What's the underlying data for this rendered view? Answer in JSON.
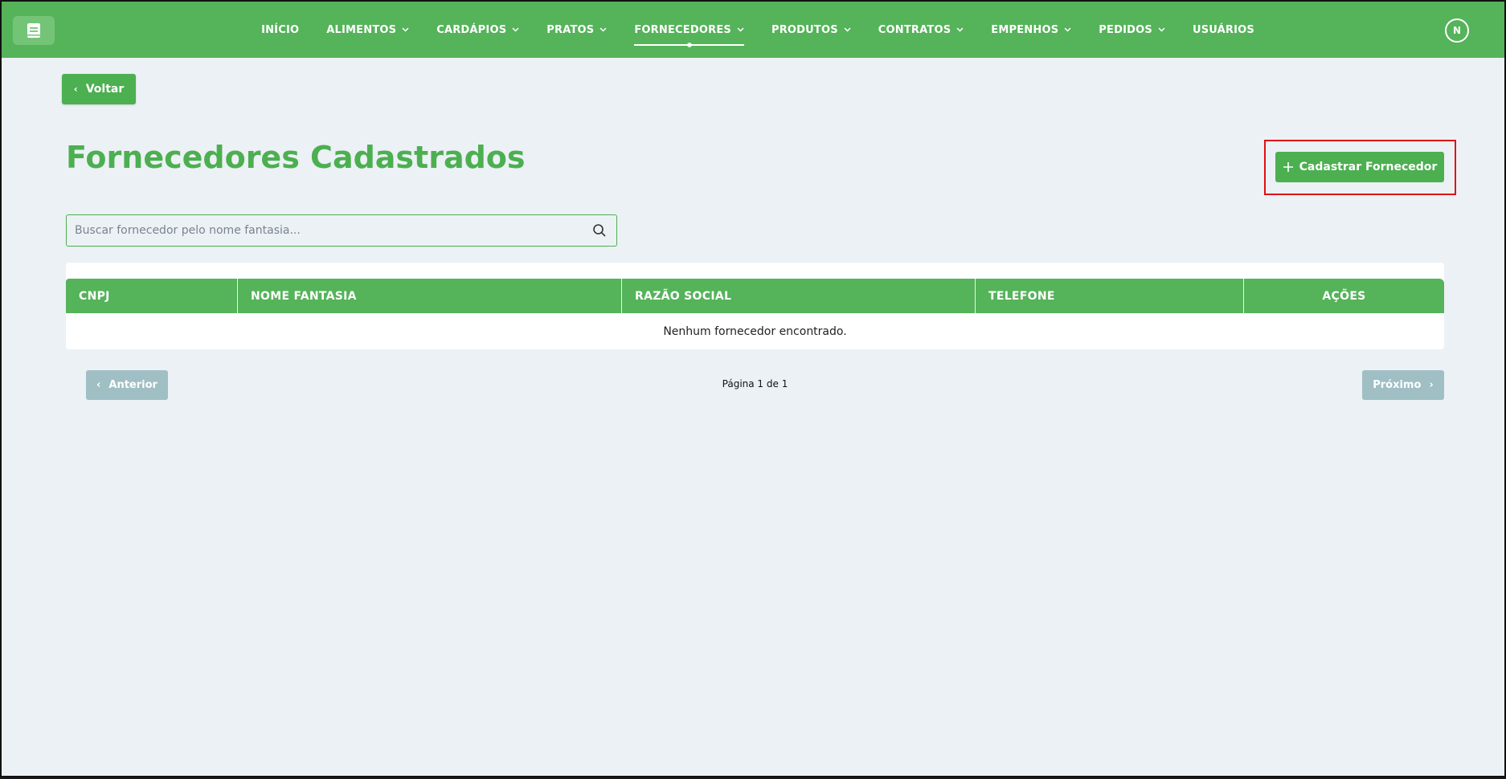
{
  "nav": {
    "items": [
      {
        "label": "INÍCIO",
        "dropdown": false,
        "active": false
      },
      {
        "label": "ALIMENTOS",
        "dropdown": true,
        "active": false
      },
      {
        "label": "CARDÁPIOS",
        "dropdown": true,
        "active": false
      },
      {
        "label": "PRATOS",
        "dropdown": true,
        "active": false
      },
      {
        "label": "FORNECEDORES",
        "dropdown": true,
        "active": true
      },
      {
        "label": "PRODUTOS",
        "dropdown": true,
        "active": false
      },
      {
        "label": "CONTRATOS",
        "dropdown": true,
        "active": false
      },
      {
        "label": "EMPENHOS",
        "dropdown": true,
        "active": false
      },
      {
        "label": "PEDIDOS",
        "dropdown": true,
        "active": false
      },
      {
        "label": "USUÁRIOS",
        "dropdown": false,
        "active": false
      }
    ],
    "avatar_initial": "N",
    "logo_icon": "book-icon"
  },
  "back_label": "Voltar",
  "page_title": "Fornecedores Cadastrados",
  "add_button_label": "Cadastrar Fornecedor",
  "search": {
    "placeholder": "Buscar fornecedor pelo nome fantasia...",
    "value": ""
  },
  "table": {
    "headers": [
      "CNPJ",
      "NOME FANTASIA",
      "RAZÃO SOCIAL",
      "TELEFONE",
      "AÇÕES"
    ],
    "empty_message": "Nenhum fornecedor encontrado."
  },
  "pagination": {
    "prev_label": "Anterior",
    "next_label": "Próximo",
    "info": "Página 1 de 1"
  },
  "colors": {
    "primary": "#55b35a",
    "button": "#4caf50",
    "disabled": "#9fbfc4",
    "background": "#ecf1f5",
    "highlight": "#e01010"
  }
}
